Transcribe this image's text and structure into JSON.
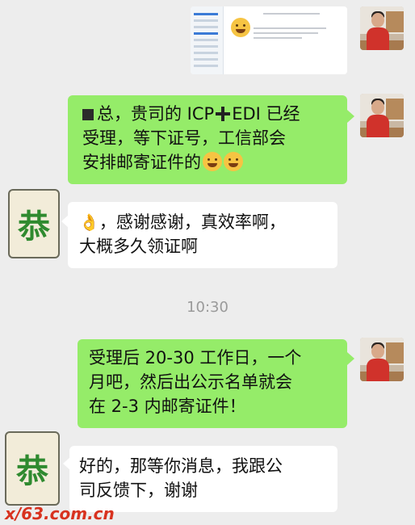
{
  "messages": [
    {
      "id": "m0",
      "sender": "me",
      "type": "image",
      "caption": "screenshot of approval page"
    },
    {
      "id": "m1",
      "sender": "me",
      "lines": [
        "总，贵司的 ICP",
        "EDI 已经",
        "受理，等下证号，工信部会",
        "安排邮寄证件的"
      ]
    },
    {
      "id": "m2",
      "sender": "other",
      "lines": [
        "，感谢感谢，真效率啊，",
        "大概多久领证啊"
      ]
    },
    {
      "id": "m3",
      "sender": "me",
      "lines": [
        "受理后 20-30 工作日，一个",
        "月吧，然后出公示名单就会",
        "在 2-3 内邮寄证件！"
      ]
    },
    {
      "id": "m4",
      "sender": "other",
      "lines": [
        "好的，那等你消息，我跟公",
        "司反馈下，谢谢"
      ]
    }
  ],
  "timestamp": "10:30",
  "other_avatar_glyph": "恭",
  "watermark": "x/63.com.cn",
  "colors": {
    "me_bubble": "#95ec69",
    "other_bubble": "#ffffff",
    "background": "#ededed"
  }
}
